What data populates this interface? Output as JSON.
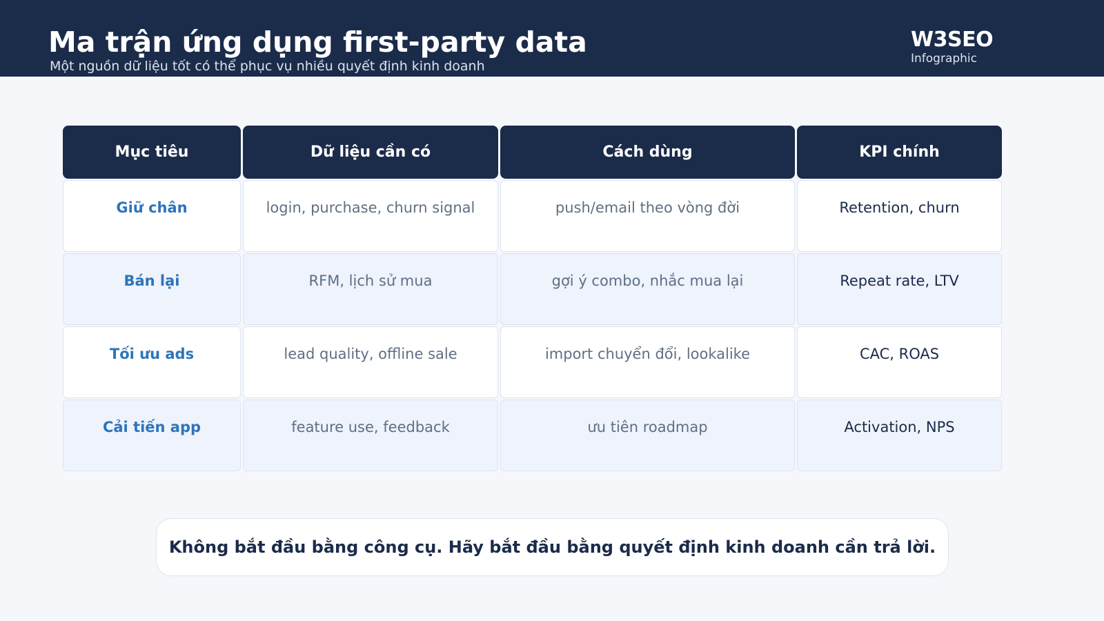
{
  "header": {
    "title": "Ma trận ứng dụng first-party data",
    "subtitle": "Một nguồn dữ liệu tốt có thể phục vụ nhiều quyết định kinh doanh",
    "brand": "W3SEO",
    "brand_sub": "Infographic"
  },
  "colors": {
    "header_bg": "#1b2b4a",
    "accent": "#2e74bb",
    "alt_row": "#eef3fc"
  },
  "table": {
    "columns": [
      "Mục tiêu",
      "Dữ liệu cần có",
      "Cách dùng",
      "KPI chính"
    ],
    "rows": [
      [
        "Giữ chân",
        "login, purchase, churn signal",
        "push/email theo vòng đời",
        "Retention, churn"
      ],
      [
        "Bán lại",
        "RFM, lịch sử mua",
        "gợi ý combo, nhắc mua lại",
        "Repeat rate, LTV"
      ],
      [
        "Tối ưu ads",
        "lead quality, offline sale",
        "import chuyển đổi, lookalike",
        "CAC, ROAS"
      ],
      [
        "Cải tiến app",
        "feature use, feedback",
        "ưu tiên roadmap",
        "Activation, NPS"
      ]
    ]
  },
  "note": "Không bắt đầu bằng công cụ. Hãy bắt đầu bằng quyết định kinh doanh cần trả lời."
}
